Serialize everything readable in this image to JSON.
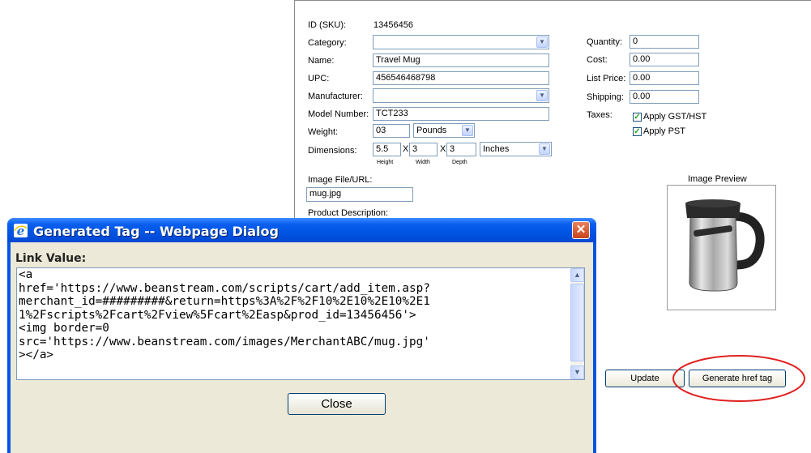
{
  "form": {
    "sku_label": "ID (SKU):",
    "sku_value": "13456456",
    "category_label": "Category:",
    "category_value": "",
    "name_label": "Name:",
    "name_value": "Travel Mug",
    "upc_label": "UPC:",
    "upc_value": "456546468798",
    "manufacturer_label": "Manufacturer:",
    "manufacturer_value": "",
    "model_label": "Model Number:",
    "model_value": "TCT233",
    "weight_label": "Weight:",
    "weight_value": "03",
    "weight_unit": "Pounds",
    "dimensions_label": "Dimensions:",
    "height_value": "5.5",
    "width_value": "3",
    "depth_value": "3",
    "dim_unit": "Inches",
    "x_sep": "X",
    "height_caption": "Height",
    "width_caption": "Width",
    "depth_caption": "Depth",
    "quantity_label": "Quantity:",
    "quantity_value": "0",
    "cost_label": "Cost:",
    "cost_value": "0.00",
    "list_price_label": "List Price:",
    "list_price_value": "0.00",
    "shipping_label": "Shipping:",
    "shipping_value": "0.00",
    "taxes_label": "Taxes:",
    "gst_label": "Apply GST/HST",
    "pst_label": "Apply PST",
    "image_file_label": "Image File/URL:",
    "image_file_value": "mug.jpg",
    "product_desc_label": "Product Description:",
    "image_preview_label": "Image Preview",
    "update_button": "Update",
    "generate_button": "Generate href tag"
  },
  "dialog": {
    "title": "Generated Tag -- Webpage Dialog",
    "link_value_label": "Link Value:",
    "link_value": "<a\nhref='https://www.beanstream.com/scripts/cart/add_item.asp?\nmerchant_id=#########&return=https%3A%2F%2F10%2E10%2E10%2E1\n1%2Fscripts%2Fcart%2Fview%5Fcart%2Easp&prod_id=13456456'>\n<img border=0\nsrc='https://www.beanstream.com/images/MerchantABC/mug.jpg'\n></a>",
    "close_button": "Close"
  },
  "icons": {
    "dialog_icon": "internet-explorer-icon",
    "close_x": "close-icon",
    "check": "check-icon",
    "dropdown": "chevron-down-icon"
  },
  "colors": {
    "titlebar": "#0054e3",
    "dialog_body": "#ece9d8",
    "input_border": "#7f9db9",
    "annotation_circle": "#e02020"
  }
}
